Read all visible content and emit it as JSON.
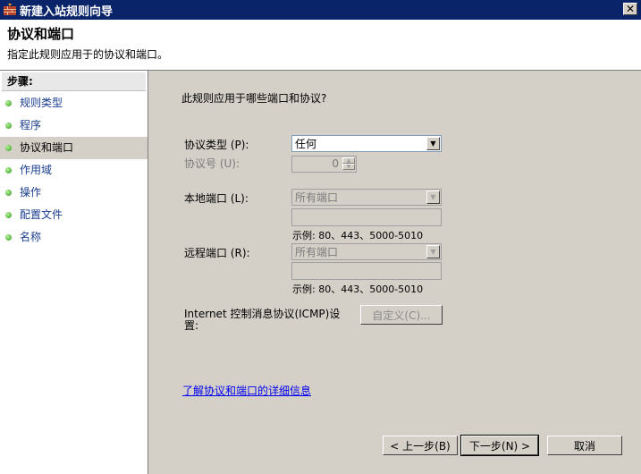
{
  "window": {
    "title": "新建入站规则向导",
    "close_glyph": "✕"
  },
  "header": {
    "title": "协议和端口",
    "subtitle": "指定此规则应用于的协议和端口。"
  },
  "sidebar": {
    "steps_label": "步骤:",
    "items": [
      {
        "label": "规则类型",
        "active": false
      },
      {
        "label": "程序",
        "active": false
      },
      {
        "label": "协议和端口",
        "active": true
      },
      {
        "label": "作用域",
        "active": false
      },
      {
        "label": "操作",
        "active": false
      },
      {
        "label": "配置文件",
        "active": false
      },
      {
        "label": "名称",
        "active": false
      }
    ]
  },
  "main": {
    "question": "此规则应用于哪些端口和协议?",
    "protocol_type": {
      "label": "协议类型 (P):",
      "value": "任何"
    },
    "protocol_number": {
      "label": "协议号 (U):",
      "value": "0"
    },
    "local_port": {
      "label": "本地端口 (L):",
      "value": "所有端口",
      "input_value": "",
      "example": "示例: 80、443、5000-5010"
    },
    "remote_port": {
      "label": "远程端口 (R):",
      "value": "所有端口",
      "input_value": "",
      "example": "示例: 80、443、5000-5010"
    },
    "icmp": {
      "label": "Internet 控制消息协议(ICMP)设置:",
      "button": "自定义(C)..."
    },
    "learn_more_link": "了解协议和端口的详细信息"
  },
  "footer": {
    "back": "< 上一步(B)",
    "next": "下一步(N) >",
    "cancel": "取消"
  },
  "colors": {
    "title_bar": "#0a246a",
    "link": "#0000ee",
    "step_link": "#1a3d8f",
    "face": "#d4d0c8"
  }
}
